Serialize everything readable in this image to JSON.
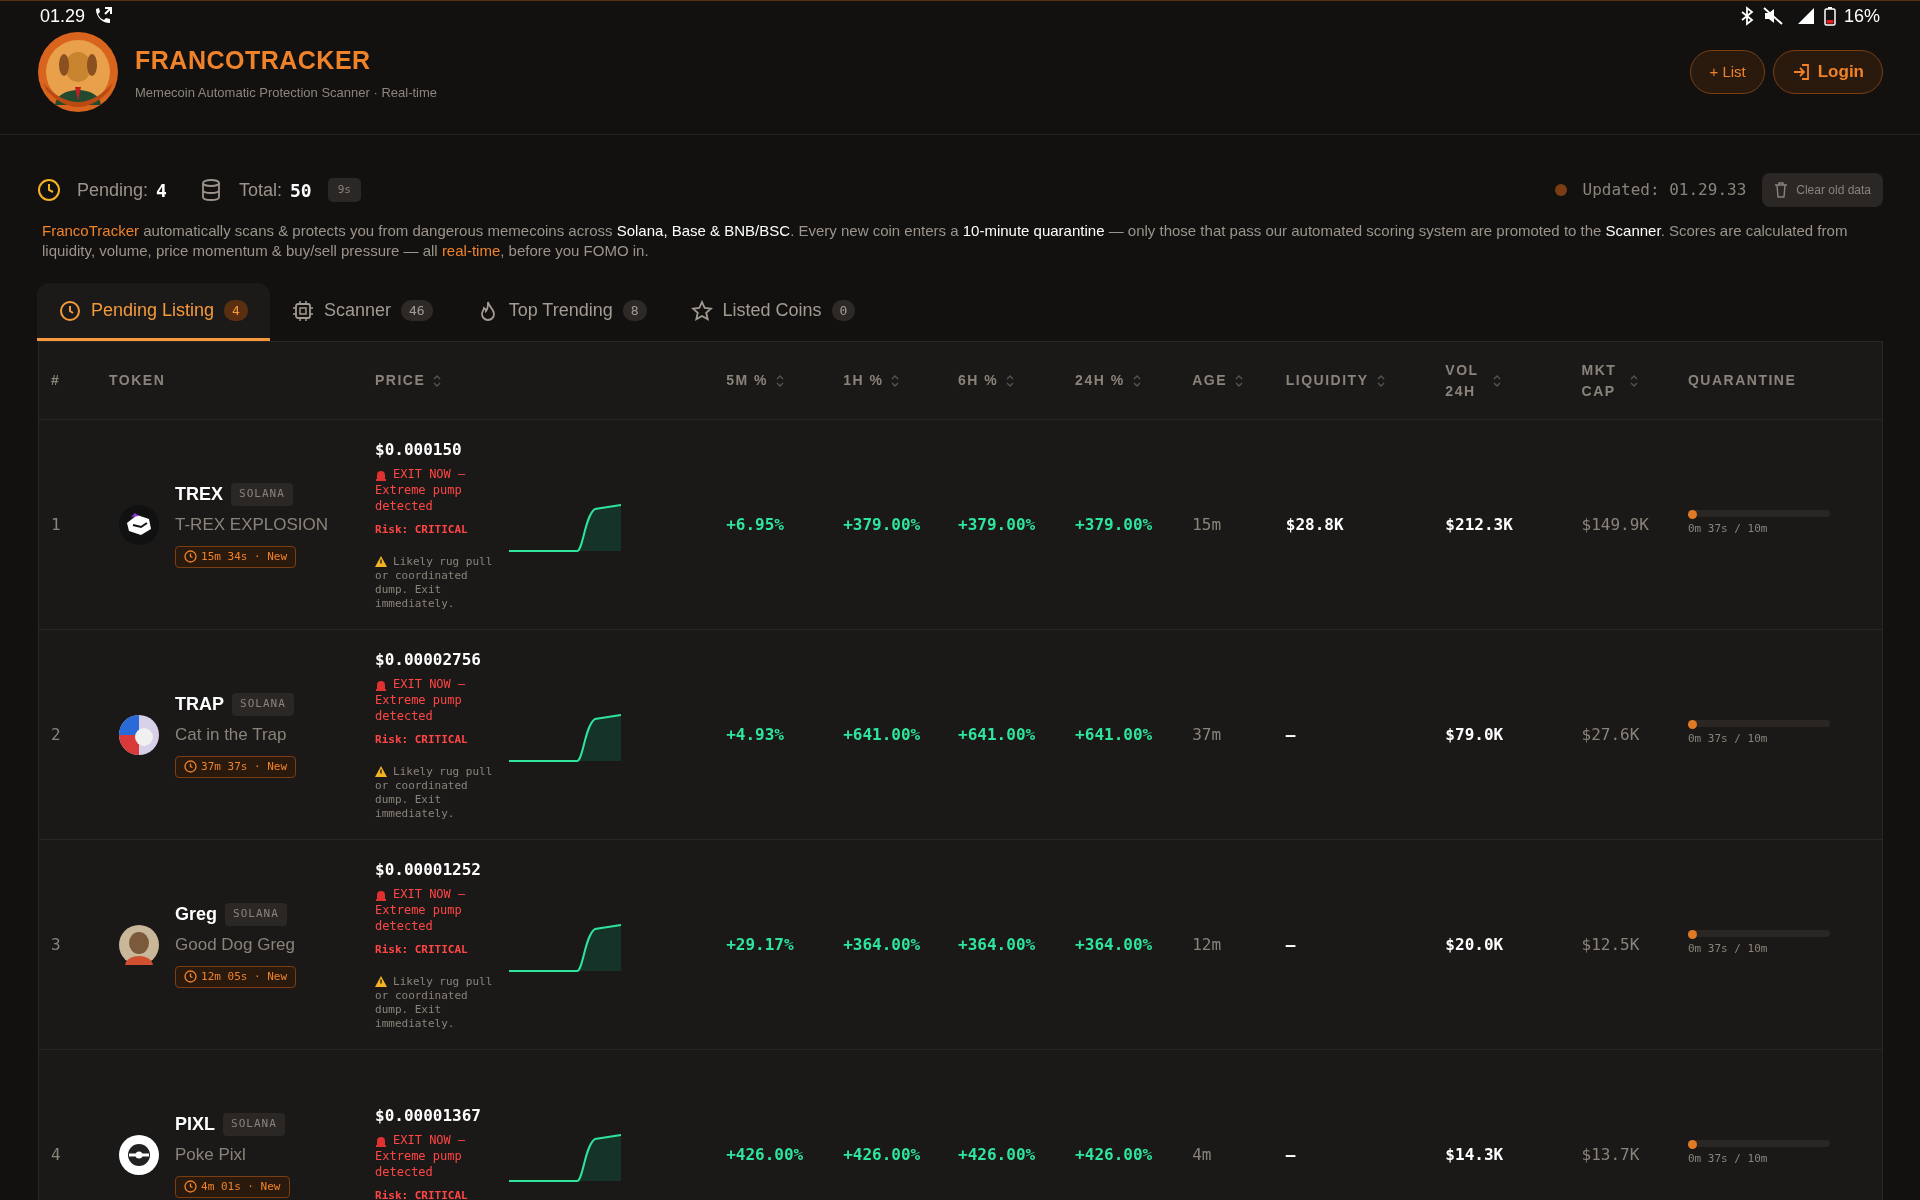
{
  "status_bar": {
    "time": "01.29",
    "battery": "16%"
  },
  "header": {
    "brand": "FRANCOTRACKER",
    "subtitle": "Memecoin Automatic Protection Scanner · Real-time",
    "buttons": [
      {
        "label": "+ List",
        "kind": "plain"
      },
      {
        "label": "Login",
        "kind": "login"
      }
    ]
  },
  "stats": {
    "pending_label": "Pending:",
    "pending": "4",
    "total_label": "Total:",
    "total": "50",
    "refresh": "9s",
    "updated": "Updated: 01.29.33",
    "clear": "Clear old data"
  },
  "description": "*FrancoTracker* automatically scans & protects you from dangerous memecoins across **Solana, Base & BNB/BSC**. Every new coin enters a **10-minute quarantine** — only those that pass our automated scoring system are promoted to the **Scanner**. Scores are calculated from liquidity, volume, price momentum & buy/sell pressure — all *real-time*, before you FOMO in.",
  "tabs": [
    {
      "label": "Pending Listing",
      "count": "4",
      "selected": true
    },
    {
      "label": "Scanner",
      "count": "46",
      "selected": false
    },
    {
      "label": "Top Trending",
      "count": "8",
      "selected": false
    },
    {
      "label": "Listed Coins",
      "count": "0",
      "selected": false
    }
  ],
  "table": {
    "columns": [
      {
        "label": "#",
        "sortable": false
      },
      {
        "label": "TOKEN",
        "sortable": false
      },
      {
        "label": "PRICE",
        "sortable": true
      },
      {
        "label": "5M %",
        "sortable": true
      },
      {
        "label": "1H %",
        "sortable": true
      },
      {
        "label": "6H %",
        "sortable": true
      },
      {
        "label": "24H %",
        "sortable": true
      },
      {
        "label": "AGE",
        "sortable": true
      },
      {
        "label": "LIQUIDITY",
        "sortable": true
      },
      {
        "label": "VOL 24H",
        "sortable": true
      },
      {
        "label": "MKT CAP",
        "sortable": true
      },
      {
        "label": "QUARANTINE",
        "sortable": false
      }
    ],
    "rows": [
      {
        "index": "1",
        "symbol": "TREX",
        "chain": "SOLANA",
        "name": "T-REX EXPLOSION",
        "age_badge": "15m 34s · New",
        "price": "$0.000150",
        "alert": "EXIT NOW — Extreme pump detected",
        "risk": "Risk: CRITICAL",
        "warning": "Likely rug pull or coordinated dump. Exit immediately.",
        "m5": "+6.95%",
        "h1": "+379.00%",
        "h6": "+379.00%",
        "h24": "+379.00%",
        "age": "15m",
        "liquidity": "$28.8K",
        "volume": "$212.3K",
        "mcap": "$149.9K",
        "quarantine": {
          "text": "0m 37s / 10m",
          "level": 0.06
        }
      },
      {
        "index": "2",
        "symbol": "TRAP",
        "chain": "SOLANA",
        "name": "Cat in the Trap",
        "age_badge": "37m 37s · New",
        "price": "$0.00002756",
        "alert": "EXIT NOW — Extreme pump detected",
        "risk": "Risk: CRITICAL",
        "warning": "Likely rug pull or coordinated dump. Exit immediately.",
        "m5": "+4.93%",
        "h1": "+641.00%",
        "h6": "+641.00%",
        "h24": "+641.00%",
        "age": "37m",
        "liquidity": "—",
        "volume": "$79.0K",
        "mcap": "$27.6K",
        "quarantine": {
          "text": "0m 37s / 10m",
          "level": 0.06
        }
      },
      {
        "index": "3",
        "symbol": "Greg",
        "chain": "SOLANA",
        "name": "Good Dog Greg",
        "age_badge": "12m 05s · New",
        "price": "$0.00001252",
        "alert": "EXIT NOW — Extreme pump detected",
        "risk": "Risk: CRITICAL",
        "warning": "Likely rug pull or coordinated dump. Exit immediately.",
        "m5": "+29.17%",
        "h1": "+364.00%",
        "h6": "+364.00%",
        "h24": "+364.00%",
        "age": "12m",
        "liquidity": "—",
        "volume": "$20.0K",
        "mcap": "$12.5K",
        "quarantine": {
          "text": "0m 37s / 10m",
          "level": 0.06
        }
      },
      {
        "index": "4",
        "symbol": "PIXL",
        "chain": "SOLANA",
        "name": "Poke Pixl",
        "age_badge": "4m 01s · New",
        "price": "$0.00001367",
        "alert": "EXIT NOW — Extreme pump detected",
        "risk": "Risk: CRITICAL",
        "m5": "+426.00%",
        "h1": "+426.00%",
        "h6": "+426.00%",
        "h24": "+426.00%",
        "age": "4m",
        "liquidity": "—",
        "volume": "$14.3K",
        "mcap": "$13.7K",
        "quarantine": {
          "text": "0m 37s / 10m",
          "level": 0.06
        }
      }
    ]
  }
}
